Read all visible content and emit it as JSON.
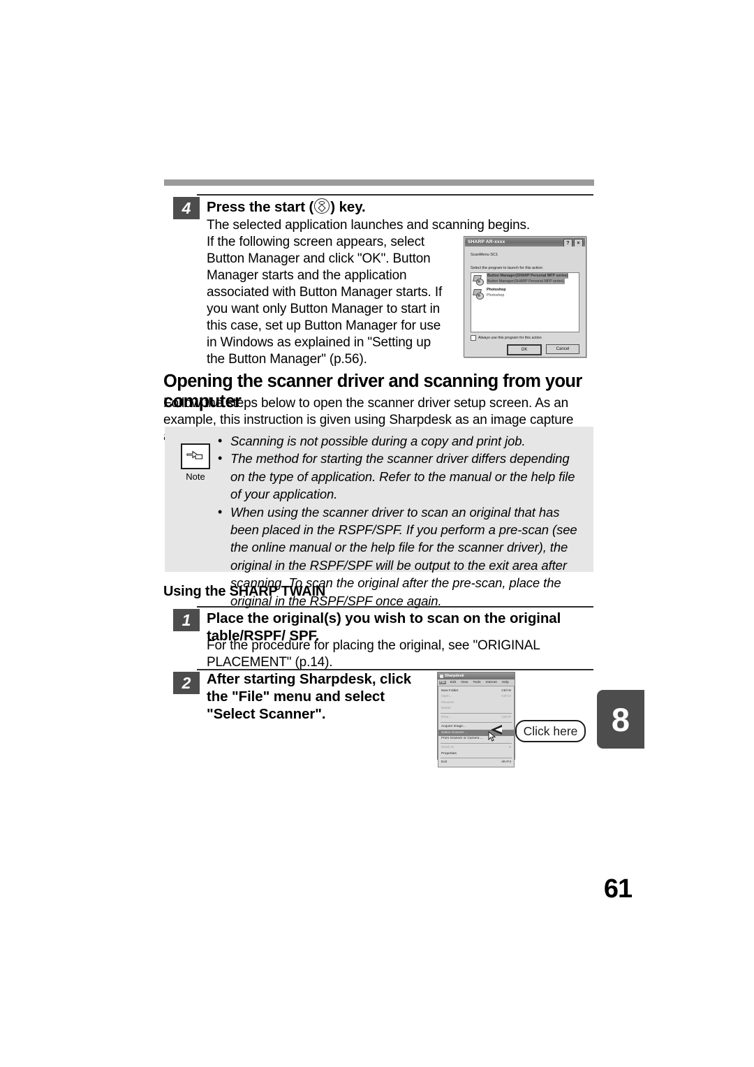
{
  "page": {
    "number": "61",
    "chapter_tab": "8"
  },
  "step4": {
    "number": "4",
    "title_before": "Press the start (",
    "title_after": ") key.",
    "start_key_icon": "start-key-icon",
    "para1": "The selected application launches and scanning begins.",
    "para2": "If the following screen appears, select Button Manager and click \"OK\". Button Manager starts and the application associated with Button Manager starts. If you want only Button Manager to start in this case, set up Button Manager for use in Windows as explained in \"Setting up the Button Manager\" (p.56)."
  },
  "dialog": {
    "title": "SHARP AR-xxxx",
    "help_button": "?",
    "close_button": "×",
    "subtitle": "ScanMenu SC1",
    "prompt": "Select the program to launch for this action:",
    "items": [
      {
        "name": "Button Manager(SHARP Personal MFP series)",
        "desc": "Button Manager(SHARP Personal MFP series)",
        "selected": true
      },
      {
        "name": "Photoshop",
        "desc": "Photoshop",
        "selected": false
      }
    ],
    "checkbox_label": "Always use this program for this action",
    "ok_label": "OK",
    "cancel_label": "Cancel"
  },
  "section": {
    "heading": "Opening the scanner driver and scanning from your computer",
    "intro": "Follow the steps below to open the scanner driver setup screen. As an example, this instruction is given using Sharpdesk as an image capture application."
  },
  "note": {
    "label": "Note",
    "icon": "pointing-hand-icon",
    "bullets": [
      "Scanning is not possible during a copy and print job.",
      "The method for starting the scanner driver differs depending on the type of application. Refer to the manual or the help file of your application.",
      "When using the scanner driver to scan an original that has been placed in the RSPF/SPF. If you perform a pre-scan (see the online manual or the help file for the scanner driver), the original in the RSPF/SPF will be output to the exit area after scanning. To scan the original after the pre-scan, place the original in the RSPF/SPF once again."
    ]
  },
  "subheading": "Using the SHARP TWAIN",
  "step1": {
    "number": "1",
    "title": "Place the original(s) you wish to scan on the original table/RSPF/ SPF.",
    "body": "For the procedure for placing the original, see \"ORIGINAL PLACEMENT\" (p.14)."
  },
  "step2": {
    "number": "2",
    "title": "After starting Sharpdesk, click the \"File\" menu and select \"Select Scanner\"."
  },
  "sharpdesk": {
    "title": "Sharpdesk",
    "menubar": [
      "File",
      "Edit",
      "View",
      "Tools",
      "Internet",
      "Help"
    ],
    "active_menu": "File",
    "menu_items": [
      {
        "label": "New Folder",
        "shortcut": "Ctrl+N",
        "state": "normal"
      },
      {
        "label": "Open...",
        "shortcut": "Ctrl+O",
        "state": "dim"
      },
      {
        "label": "Rename",
        "shortcut": "",
        "state": "dim"
      },
      {
        "label": "Delete",
        "shortcut": "",
        "state": "dim"
      },
      {
        "sep": true
      },
      {
        "label": "Print...",
        "shortcut": "Ctrl+P",
        "state": "dim"
      },
      {
        "sep": true
      },
      {
        "label": "Acquire Image...",
        "shortcut": "",
        "state": "normal"
      },
      {
        "label": "Select Scanner ...",
        "shortcut": "",
        "state": "selected"
      },
      {
        "label": "From Scanner or Camera ...",
        "shortcut": "",
        "state": "normal"
      },
      {
        "sep": true
      },
      {
        "label": "Send As",
        "shortcut": "▸",
        "state": "dim"
      },
      {
        "label": "Properties",
        "shortcut": "",
        "state": "normal"
      },
      {
        "sep": true
      },
      {
        "label": "Exit",
        "shortcut": "Alt+F4",
        "state": "normal"
      }
    ]
  },
  "callout": {
    "text": "Click here"
  }
}
